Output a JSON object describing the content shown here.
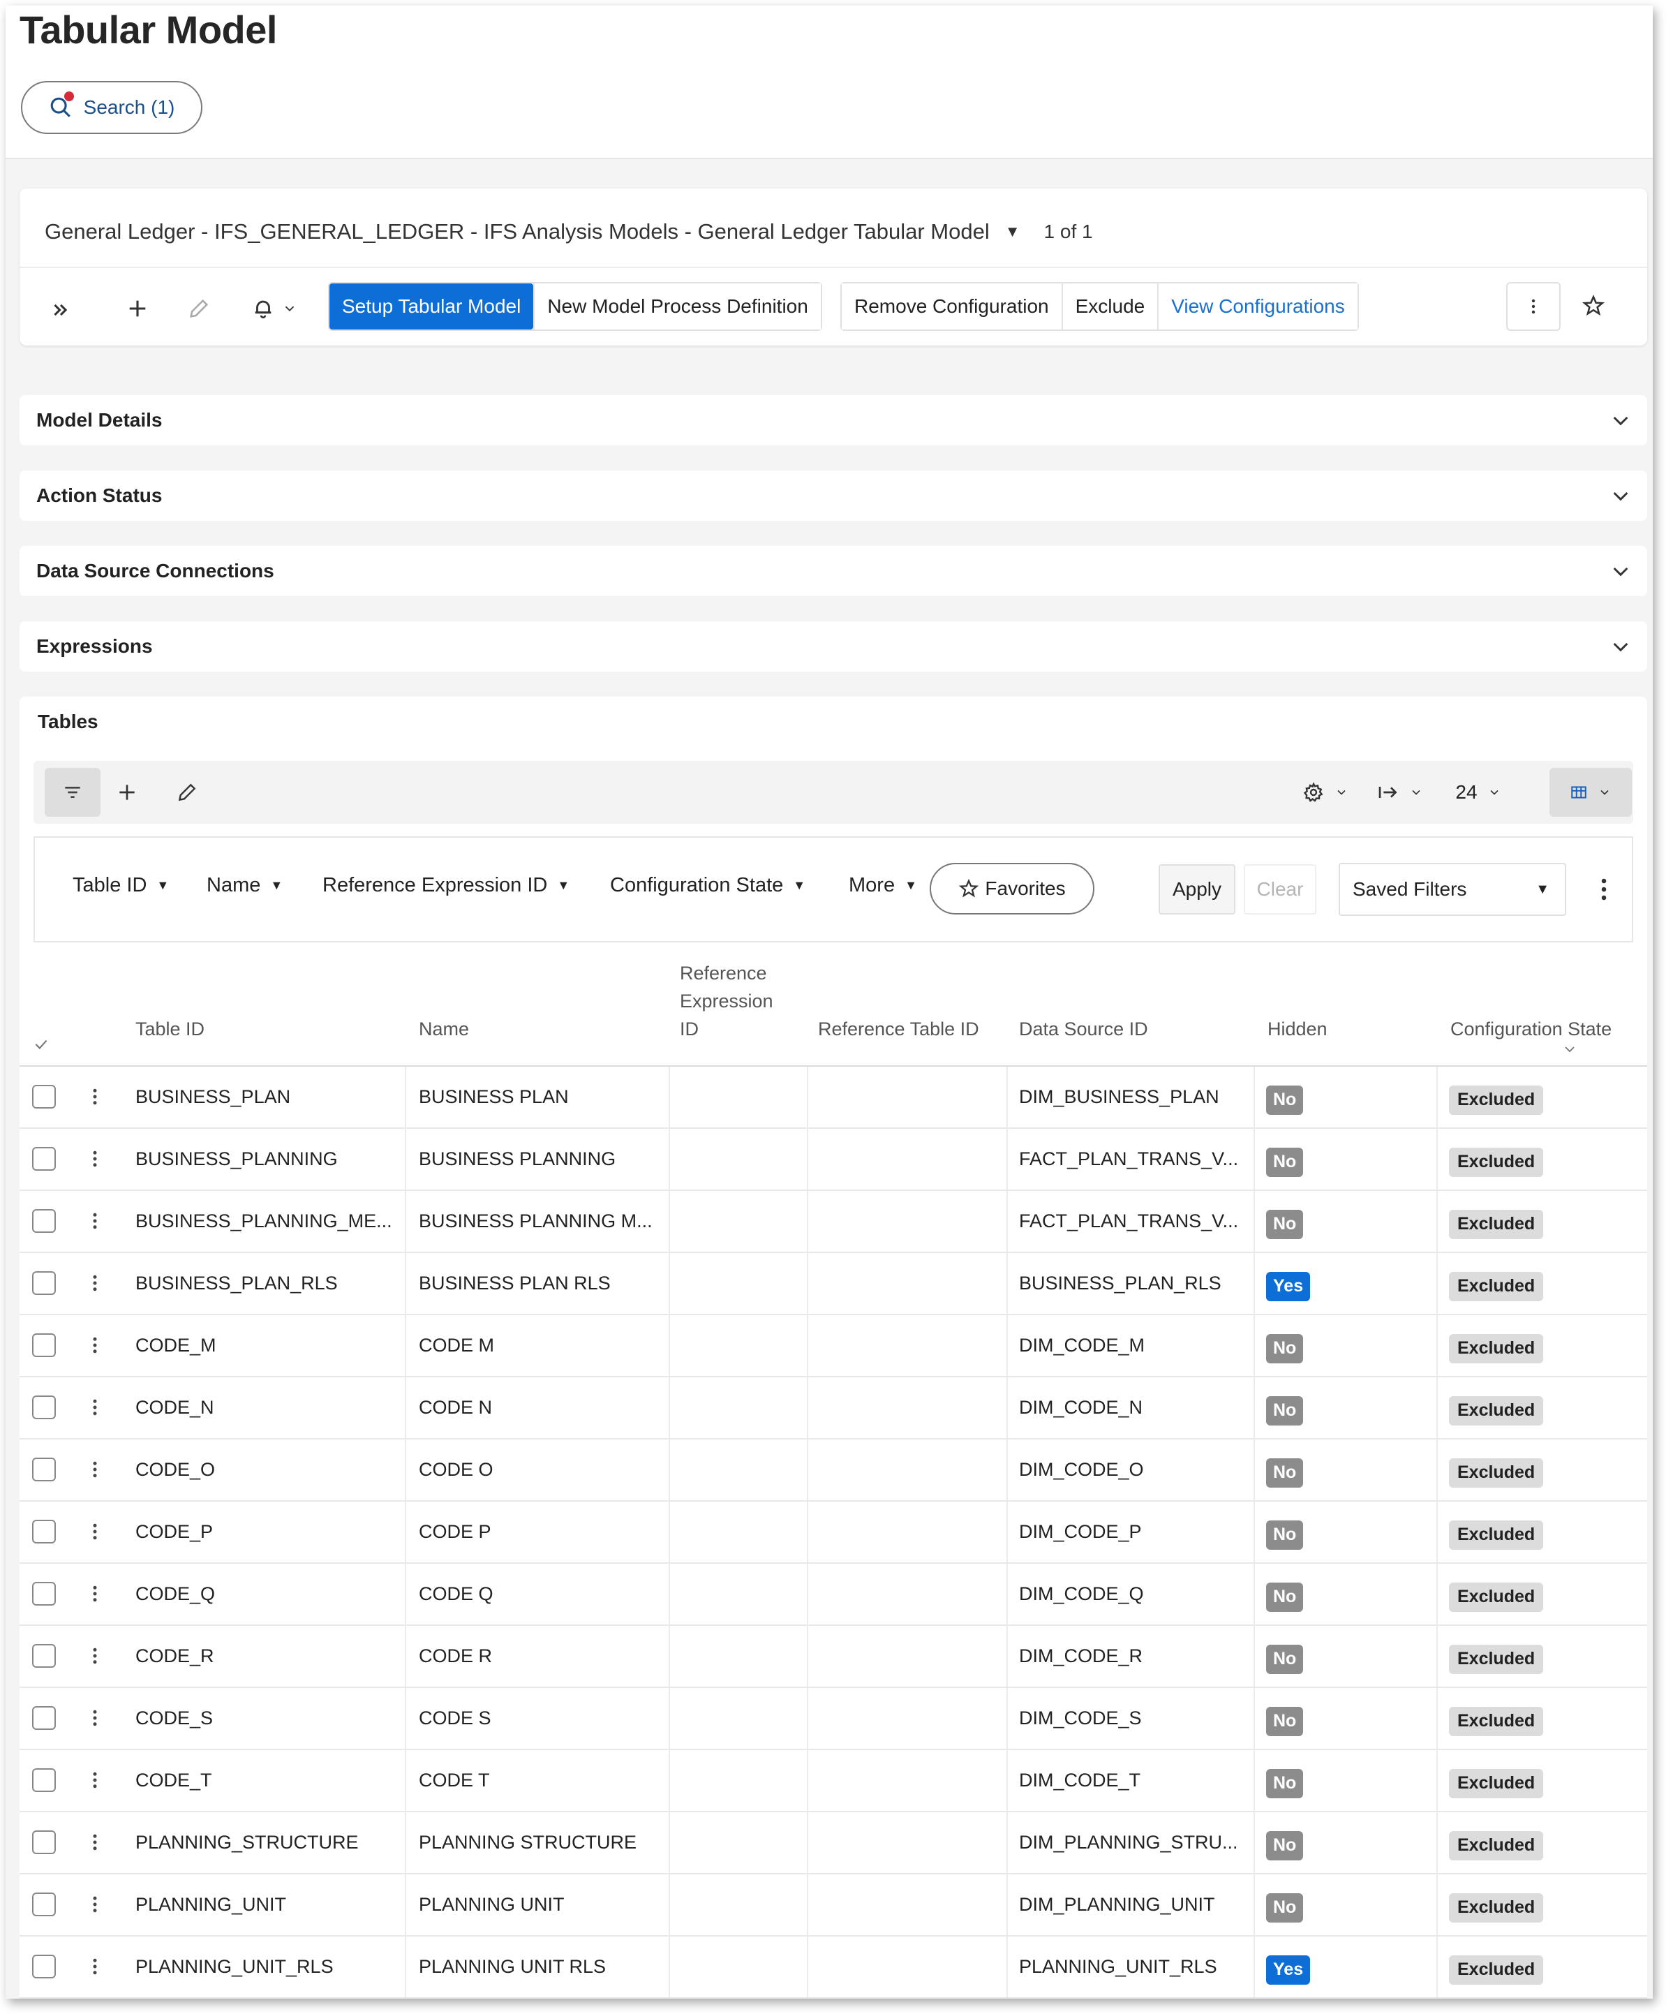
{
  "page": {
    "title": "Tabular Model",
    "search_label": "Search (1)"
  },
  "record": {
    "title": "General Ledger - IFS_GENERAL_LEDGER - IFS Analysis Models - General Ledger Tabular Model",
    "count": "1 of 1"
  },
  "toolbar": {
    "setup_label": "Setup Tabular Model",
    "new_def_label": "New Model Process Definition",
    "remove_config_label": "Remove Configuration",
    "exclude_label": "Exclude",
    "view_config_label": "View Configurations"
  },
  "sections": {
    "model_details": "Model Details",
    "action_status": "Action Status",
    "data_source_connections": "Data Source Connections",
    "expressions": "Expressions",
    "tables": "Tables"
  },
  "table_toolbar": {
    "page_size": "24"
  },
  "filters": {
    "table_id": "Table ID",
    "name": "Name",
    "ref_expr_id": "Reference Expression ID",
    "config_state": "Configuration State",
    "more": "More",
    "favorites": "Favorites",
    "apply": "Apply",
    "clear": "Clear",
    "saved_filters": "Saved Filters"
  },
  "columns": {
    "table_id": "Table ID",
    "name": "Name",
    "ref_expr_line1": "Reference",
    "ref_expr_line2": "Expression",
    "ref_expr_line3": "ID",
    "ref_table_id": "Reference Table ID",
    "data_source_id": "Data Source ID",
    "hidden": "Hidden",
    "config_state": "Configuration State"
  },
  "rows": [
    {
      "table_id": "BUSINESS_PLAN",
      "name": "BUSINESS PLAN",
      "ref_expr": "",
      "ref_table": "",
      "data_source": "DIM_BUSINESS_PLAN",
      "hidden": "No",
      "state": "Excluded"
    },
    {
      "table_id": "BUSINESS_PLANNING",
      "name": "BUSINESS PLANNING",
      "ref_expr": "",
      "ref_table": "",
      "data_source": "FACT_PLAN_TRANS_V...",
      "hidden": "No",
      "state": "Excluded"
    },
    {
      "table_id": "BUSINESS_PLANNING_ME...",
      "name": "BUSINESS PLANNING M...",
      "ref_expr": "",
      "ref_table": "",
      "data_source": "FACT_PLAN_TRANS_V...",
      "hidden": "No",
      "state": "Excluded"
    },
    {
      "table_id": "BUSINESS_PLAN_RLS",
      "name": "BUSINESS PLAN RLS",
      "ref_expr": "",
      "ref_table": "",
      "data_source": "BUSINESS_PLAN_RLS",
      "hidden": "Yes",
      "state": "Excluded"
    },
    {
      "table_id": "CODE_M",
      "name": "CODE M",
      "ref_expr": "",
      "ref_table": "",
      "data_source": "DIM_CODE_M",
      "hidden": "No",
      "state": "Excluded"
    },
    {
      "table_id": "CODE_N",
      "name": "CODE N",
      "ref_expr": "",
      "ref_table": "",
      "data_source": "DIM_CODE_N",
      "hidden": "No",
      "state": "Excluded"
    },
    {
      "table_id": "CODE_O",
      "name": "CODE O",
      "ref_expr": "",
      "ref_table": "",
      "data_source": "DIM_CODE_O",
      "hidden": "No",
      "state": "Excluded"
    },
    {
      "table_id": "CODE_P",
      "name": "CODE P",
      "ref_expr": "",
      "ref_table": "",
      "data_source": "DIM_CODE_P",
      "hidden": "No",
      "state": "Excluded"
    },
    {
      "table_id": "CODE_Q",
      "name": "CODE Q",
      "ref_expr": "",
      "ref_table": "",
      "data_source": "DIM_CODE_Q",
      "hidden": "No",
      "state": "Excluded"
    },
    {
      "table_id": "CODE_R",
      "name": "CODE R",
      "ref_expr": "",
      "ref_table": "",
      "data_source": "DIM_CODE_R",
      "hidden": "No",
      "state": "Excluded"
    },
    {
      "table_id": "CODE_S",
      "name": "CODE S",
      "ref_expr": "",
      "ref_table": "",
      "data_source": "DIM_CODE_S",
      "hidden": "No",
      "state": "Excluded"
    },
    {
      "table_id": "CODE_T",
      "name": "CODE T",
      "ref_expr": "",
      "ref_table": "",
      "data_source": "DIM_CODE_T",
      "hidden": "No",
      "state": "Excluded"
    },
    {
      "table_id": "PLANNING_STRUCTURE",
      "name": "PLANNING STRUCTURE",
      "ref_expr": "",
      "ref_table": "",
      "data_source": "DIM_PLANNING_STRU...",
      "hidden": "No",
      "state": "Excluded"
    },
    {
      "table_id": "PLANNING_UNIT",
      "name": "PLANNING UNIT",
      "ref_expr": "",
      "ref_table": "",
      "data_source": "DIM_PLANNING_UNIT",
      "hidden": "No",
      "state": "Excluded"
    },
    {
      "table_id": "PLANNING_UNIT_RLS",
      "name": "PLANNING UNIT RLS",
      "ref_expr": "",
      "ref_table": "",
      "data_source": "PLANNING_UNIT_RLS",
      "hidden": "Yes",
      "state": "Excluded"
    }
  ],
  "colors": {
    "primary": "#0d6ed8",
    "badge_no": "#8c8c8c",
    "badge_excluded": "#dcdcdc",
    "link": "#1a6fd0"
  },
  "icons": {
    "search": "search-icon",
    "expand": "double-chevron-right-icon",
    "add": "plus-icon",
    "edit": "pencil-icon",
    "notify": "bell-icon",
    "kebab": "kebab-icon",
    "favorite": "star-icon",
    "filter": "filter-icon",
    "settings": "gear-icon",
    "export": "arrow-right-bar-icon",
    "layout": "table-layout-icon"
  }
}
